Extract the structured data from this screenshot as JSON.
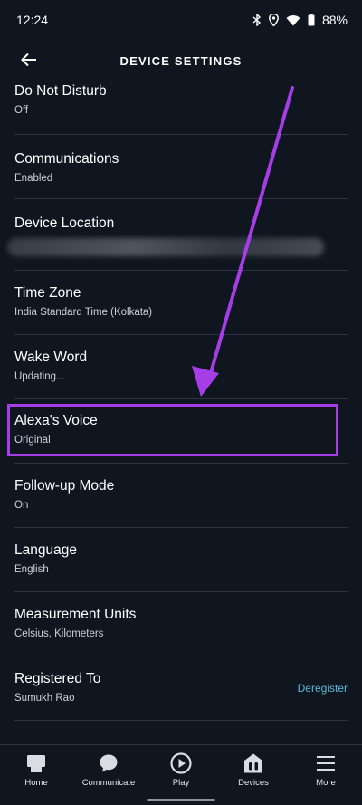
{
  "status_bar": {
    "time": "12:24",
    "battery": "88%",
    "icons": [
      "bluetooth-icon",
      "location-icon",
      "wifi-icon",
      "battery-icon"
    ]
  },
  "header": {
    "title": "DEVICE SETTINGS",
    "back_icon": "back-arrow-icon"
  },
  "settings": [
    {
      "title": "Do Not Disturb",
      "subtitle": "Off"
    },
    {
      "title": "Communications",
      "subtitle": "Enabled"
    },
    {
      "title": "Device Location",
      "subtitle": ""
    },
    {
      "title": "Time Zone",
      "subtitle": "India Standard Time (Kolkata)"
    },
    {
      "title": "Wake Word",
      "subtitle": "Updating..."
    },
    {
      "title": "Alexa's Voice",
      "subtitle": "Original"
    },
    {
      "title": "Follow-up Mode",
      "subtitle": "On"
    },
    {
      "title": "Language",
      "subtitle": "English"
    },
    {
      "title": "Measurement Units",
      "subtitle": "Celsius, Kilometers"
    },
    {
      "title": "Registered To",
      "subtitle": "Sumukh Rao",
      "action": "Deregister"
    }
  ],
  "bottom_nav": [
    {
      "label": "Home",
      "icon": "home-icon"
    },
    {
      "label": "Communicate",
      "icon": "chat-bubble-icon"
    },
    {
      "label": "Play",
      "icon": "play-icon"
    },
    {
      "label": "Devices",
      "icon": "devices-icon"
    },
    {
      "label": "More",
      "icon": "menu-icon"
    }
  ],
  "colors": {
    "background": "#0f1620",
    "annotation": "#a63ee8",
    "link": "#5cb8d6"
  }
}
